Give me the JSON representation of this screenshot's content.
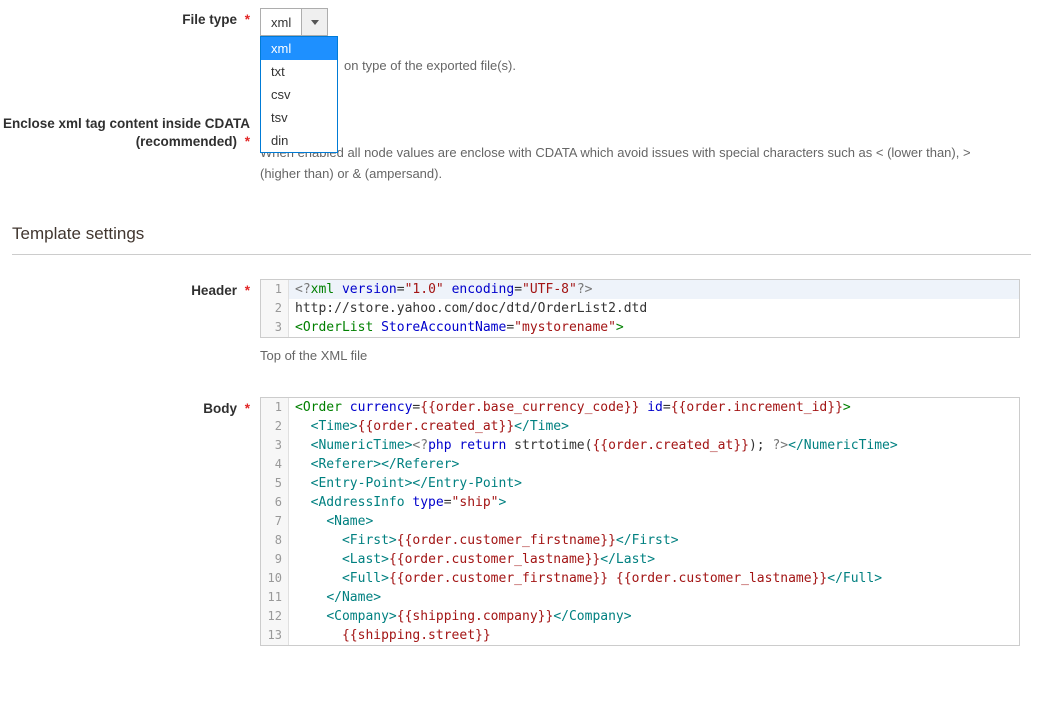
{
  "file_type": {
    "label": "File type",
    "value": "xml",
    "options": [
      "xml",
      "txt",
      "csv",
      "tsv",
      "din"
    ],
    "help_suffix": "on type of the exported file(s)."
  },
  "cdata": {
    "label": "Enclose xml tag content inside CDATA (recommended)",
    "help": "When enabled all node values are enclose with CDATA which avoid issues with special characters such as < (lower than), > (higher than) or & (ampersand)."
  },
  "template_section": "Template settings",
  "header": {
    "label": "Header",
    "help": "Top of the XML file",
    "lines": [
      {
        "n": "1",
        "tokens": [
          {
            "c": "pi",
            "t": "<?"
          },
          {
            "c": "tag",
            "t": "xml"
          },
          {
            "c": "txt",
            "t": " "
          },
          {
            "c": "attr",
            "t": "version"
          },
          {
            "c": "txt",
            "t": "="
          },
          {
            "c": "str",
            "t": "\"1.0\""
          },
          {
            "c": "txt",
            "t": " "
          },
          {
            "c": "attr",
            "t": "encoding"
          },
          {
            "c": "txt",
            "t": "="
          },
          {
            "c": "str",
            "t": "\"UTF-8\""
          },
          {
            "c": "pi",
            "t": "?>"
          }
        ]
      },
      {
        "n": "2",
        "tokens": [
          {
            "c": "txt",
            "t": "http://store.yahoo.com/doc/dtd/OrderList2.dtd"
          }
        ]
      },
      {
        "n": "3",
        "tokens": [
          {
            "c": "tag",
            "t": "<OrderList"
          },
          {
            "c": "txt",
            "t": " "
          },
          {
            "c": "attr",
            "t": "StoreAccountName"
          },
          {
            "c": "txt",
            "t": "="
          },
          {
            "c": "str",
            "t": "\"mystorename\""
          },
          {
            "c": "tag",
            "t": ">"
          }
        ]
      }
    ]
  },
  "body": {
    "label": "Body",
    "lines": [
      {
        "n": "1",
        "tokens": [
          {
            "c": "tag",
            "t": "<Order"
          },
          {
            "c": "txt",
            "t": " "
          },
          {
            "c": "attr",
            "t": "currency"
          },
          {
            "c": "txt",
            "t": "="
          },
          {
            "c": "var",
            "t": "{{order.base_currency_code}}"
          },
          {
            "c": "txt",
            "t": " "
          },
          {
            "c": "attr",
            "t": "id"
          },
          {
            "c": "txt",
            "t": "="
          },
          {
            "c": "var",
            "t": "{{order.increment_id}}"
          },
          {
            "c": "tag",
            "t": ">"
          }
        ]
      },
      {
        "n": "2",
        "tokens": [
          {
            "c": "txt",
            "t": "  "
          },
          {
            "c": "t2",
            "t": "<Time>"
          },
          {
            "c": "var",
            "t": "{{order.created_at}}"
          },
          {
            "c": "t2",
            "t": "</Time>"
          }
        ]
      },
      {
        "n": "3",
        "tokens": [
          {
            "c": "txt",
            "t": "  "
          },
          {
            "c": "t2",
            "t": "<NumericTime>"
          },
          {
            "c": "pi",
            "t": "<?"
          },
          {
            "c": "kw",
            "t": "php"
          },
          {
            "c": "txt",
            "t": " "
          },
          {
            "c": "kw",
            "t": "return"
          },
          {
            "c": "txt",
            "t": " strtotime("
          },
          {
            "c": "var",
            "t": "{{order.created_at}}"
          },
          {
            "c": "txt",
            "t": "); "
          },
          {
            "c": "pi",
            "t": "?>"
          },
          {
            "c": "t2",
            "t": "</NumericTime>"
          }
        ]
      },
      {
        "n": "4",
        "tokens": [
          {
            "c": "txt",
            "t": "  "
          },
          {
            "c": "t2",
            "t": "<Referer></Referer>"
          }
        ]
      },
      {
        "n": "5",
        "tokens": [
          {
            "c": "txt",
            "t": "  "
          },
          {
            "c": "t2",
            "t": "<Entry-Point></Entry-Point>"
          }
        ]
      },
      {
        "n": "6",
        "tokens": [
          {
            "c": "txt",
            "t": "  "
          },
          {
            "c": "t2",
            "t": "<AddressInfo"
          },
          {
            "c": "txt",
            "t": " "
          },
          {
            "c": "attr",
            "t": "type"
          },
          {
            "c": "txt",
            "t": "="
          },
          {
            "c": "str",
            "t": "\"ship\""
          },
          {
            "c": "t2",
            "t": ">"
          }
        ]
      },
      {
        "n": "7",
        "tokens": [
          {
            "c": "txt",
            "t": "    "
          },
          {
            "c": "t2",
            "t": "<Name>"
          }
        ]
      },
      {
        "n": "8",
        "tokens": [
          {
            "c": "txt",
            "t": "      "
          },
          {
            "c": "t2",
            "t": "<First>"
          },
          {
            "c": "var",
            "t": "{{order.customer_firstname}}"
          },
          {
            "c": "t2",
            "t": "</First>"
          }
        ]
      },
      {
        "n": "9",
        "tokens": [
          {
            "c": "txt",
            "t": "      "
          },
          {
            "c": "t2",
            "t": "<Last>"
          },
          {
            "c": "var",
            "t": "{{order.customer_lastname}}"
          },
          {
            "c": "t2",
            "t": "</Last>"
          }
        ]
      },
      {
        "n": "10",
        "tokens": [
          {
            "c": "txt",
            "t": "      "
          },
          {
            "c": "t2",
            "t": "<Full>"
          },
          {
            "c": "var",
            "t": "{{order.customer_firstname}}"
          },
          {
            "c": "txt",
            "t": " "
          },
          {
            "c": "var",
            "t": "{{order.customer_lastname}}"
          },
          {
            "c": "t2",
            "t": "</Full>"
          }
        ]
      },
      {
        "n": "11",
        "tokens": [
          {
            "c": "txt",
            "t": "    "
          },
          {
            "c": "t2",
            "t": "</Name>"
          }
        ]
      },
      {
        "n": "12",
        "tokens": [
          {
            "c": "txt",
            "t": "    "
          },
          {
            "c": "t2",
            "t": "<Company>"
          },
          {
            "c": "var",
            "t": "{{shipping.company}}"
          },
          {
            "c": "t2",
            "t": "</Company>"
          }
        ]
      },
      {
        "n": "13",
        "tokens": [
          {
            "c": "txt",
            "t": "      "
          },
          {
            "c": "var",
            "t": "{{shipping.street}}"
          }
        ]
      }
    ]
  }
}
